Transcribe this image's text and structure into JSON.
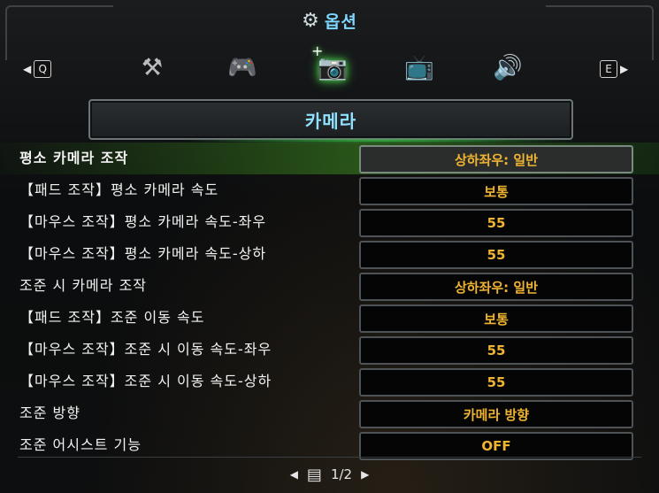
{
  "header": {
    "gear_icon": "⚙",
    "title": "옵션"
  },
  "tabbar": {
    "prev_key": "Q",
    "next_key": "E",
    "tabs": [
      {
        "name": "game-settings-icon",
        "glyph": "⚒",
        "active": false
      },
      {
        "name": "controller-icon",
        "glyph": "🎮",
        "active": false
      },
      {
        "name": "camera-icon",
        "glyph": "📷",
        "active": true
      },
      {
        "name": "display-tv-icon",
        "glyph": "📺",
        "active": false
      },
      {
        "name": "audio-speaker-icon",
        "glyph": "🔊",
        "active": false
      }
    ]
  },
  "category": {
    "title": "카메라"
  },
  "settings": [
    {
      "label": "평소 카메라 조작",
      "value": "상하좌우: 일반",
      "selected": true
    },
    {
      "label": "【패드 조작】평소 카메라 속도",
      "value": "보통",
      "selected": false
    },
    {
      "label": "【마우스 조작】평소 카메라 속도-좌우",
      "value": "55",
      "selected": false
    },
    {
      "label": "【마우스 조작】평소 카메라 속도-상하",
      "value": "55",
      "selected": false
    },
    {
      "label": "조준 시 카메라 조작",
      "value": "상하좌우: 일반",
      "selected": false
    },
    {
      "label": "【패드 조작】조준 이동 속도",
      "value": "보통",
      "selected": false
    },
    {
      "label": "【마우스 조작】조준 시 이동 속도-좌우",
      "value": "55",
      "selected": false
    },
    {
      "label": "【마우스 조작】조준 시 이동 속도-상하",
      "value": "55",
      "selected": false
    },
    {
      "label": "조준 방향",
      "value": "카메라 방향",
      "selected": false
    },
    {
      "label": "조준 어시스트 기능",
      "value": "OFF",
      "selected": false
    }
  ],
  "pager": {
    "page": "1/2"
  },
  "colors": {
    "accent_title": "#7fd8ff",
    "value_text": "#f0b432",
    "selection_glow": "#49c84b"
  }
}
